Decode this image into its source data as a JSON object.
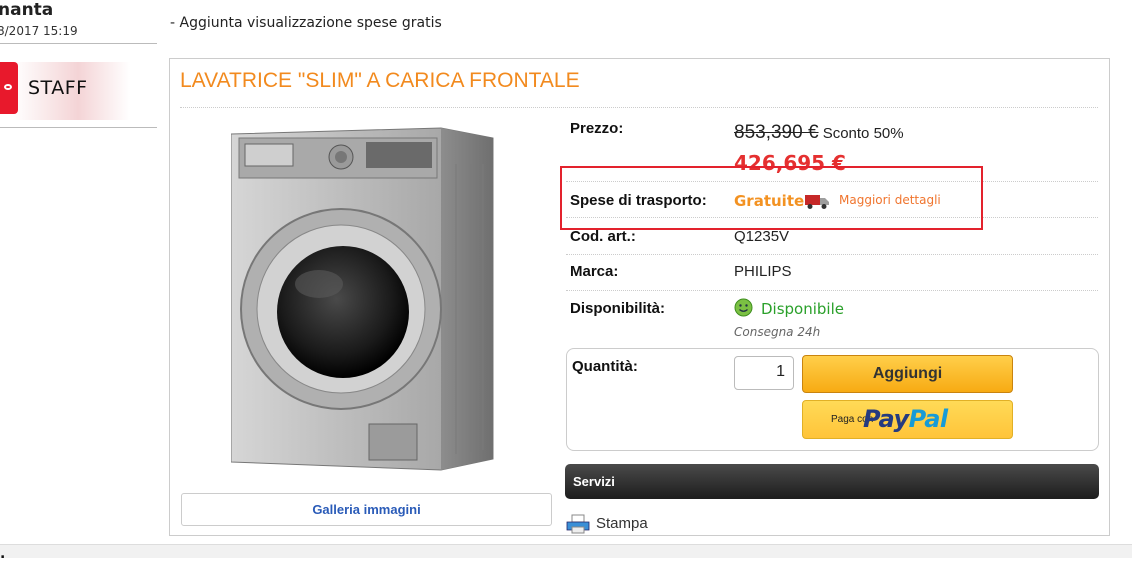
{
  "post": {
    "author": "nanta",
    "date": "8/2017 15:19",
    "role_badge": "STAFF",
    "message": "- Aggiunta visualizzazione spese gratis"
  },
  "product": {
    "title": "LAVATRICE \"SLIM\" A CARICA FRONTALE",
    "gallery_label": "Galleria immagini",
    "price_label": "Prezzo:",
    "old_price": "853,390 €",
    "discount": "Sconto 50%",
    "new_price": "426,695 €",
    "shipping_label": "Spese di trasporto:",
    "shipping_value": "Gratuite",
    "shipping_more": "Maggiori dettagli",
    "code_label": "Cod. art.:",
    "code_value": "Q1235V",
    "brand_label": "Marca:",
    "brand_value": "PHILIPS",
    "availability_label": "Disponibilità:",
    "availability_value": "Disponibile",
    "delivery_note": "Consegna 24h",
    "quantity_label": "Quantità:",
    "quantity_value": "1",
    "add_button": "Aggiungi",
    "paypal_prefix": "Paga con",
    "paypal_word_a": "Pay",
    "paypal_word_b": "Pal",
    "services_label": "Servizi",
    "print_label": "Stampa"
  },
  "colors": {
    "title": "#f28a1e",
    "new_price": "#e53030",
    "highlight_border": "#e3222d",
    "available": "#2aa02a",
    "add_button": "#f7ab13",
    "paypal_button": "#ffc439"
  },
  "bottom": {
    "fragment": "."
  }
}
